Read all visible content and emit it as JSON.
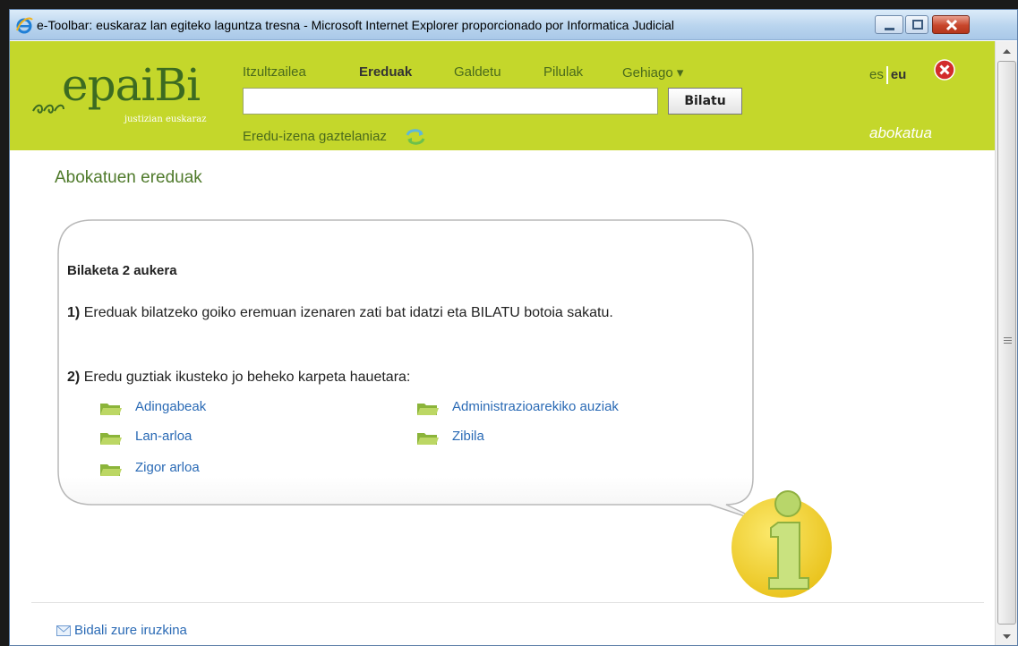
{
  "window": {
    "title": "e-Toolbar: euskaraz lan egiteko laguntza tresna - Microsoft Internet Explorer proporcionado por Informatica Judicial",
    "buttons": [
      "minimize",
      "maximize",
      "close"
    ]
  },
  "logo": {
    "name": "epaiBi",
    "tagline": "justizian euskaraz"
  },
  "nav": {
    "items": [
      {
        "label": "Itzultzailea"
      },
      {
        "label": "Ereduak",
        "active": true
      },
      {
        "label": "Galdetu"
      },
      {
        "label": "Pilulak"
      },
      {
        "label": "Gehiago ▾"
      }
    ]
  },
  "search": {
    "value": "",
    "button_label": "Bilatu"
  },
  "eredu_lang_label": "Eredu-izena gaztelaniaz",
  "lang": {
    "es": "es",
    "eu": "eu",
    "selected": "eu"
  },
  "role_label": "abokatua",
  "page_heading": "Abokatuen ereduak",
  "info_box": {
    "title": "Bilaketa 2 aukera",
    "step1_num": "1)",
    "step1_text": "Ereduak bilatzeko goiko eremuan izenaren zati bat idatzi eta BILATU botoia sakatu.",
    "step2_num": "2)",
    "step2_text": "Eredu guztiak ikusteko jo beheko karpeta hauetara:",
    "folders": [
      {
        "label": "Adingabeak"
      },
      {
        "label": "Administrazioarekiko auziak"
      },
      {
        "label": "Lan-arloa"
      },
      {
        "label": "Zibila"
      },
      {
        "label": "Zigor arloa"
      }
    ]
  },
  "feedback_link": "Bidali zure iruzkina",
  "colors": {
    "header_bg": "#c4d72b",
    "heading_green": "#4f7a2b",
    "link_blue": "#2a6ab5",
    "info_yellow": "#f2d52a"
  }
}
